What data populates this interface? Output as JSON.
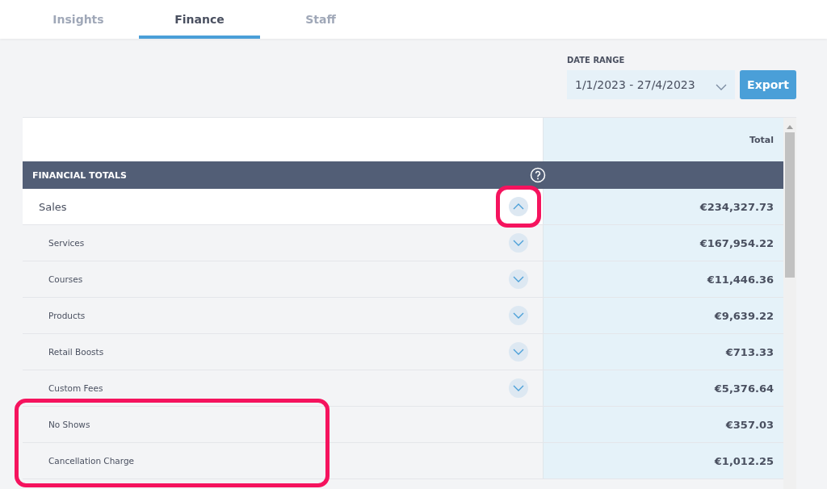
{
  "tabs": [
    {
      "label": "Insights",
      "selected": false
    },
    {
      "label": "Finance",
      "selected": true
    },
    {
      "label": "Staff",
      "selected": false
    }
  ],
  "date_range": {
    "label": "DATE RANGE",
    "value": "1/1/2023 - 27/4/2023"
  },
  "export_button": "Export",
  "table": {
    "column_header": "Total",
    "section": {
      "title": "FINANCIAL TOTALS"
    },
    "rows": [
      {
        "kind": "parent",
        "label": "Sales",
        "value": "€234,327.73",
        "expanded": true,
        "highlighted": true
      },
      {
        "kind": "child",
        "label": "Services",
        "value": "€167,954.22",
        "expanded": false,
        "highlighted": false
      },
      {
        "kind": "child",
        "label": "Courses",
        "value": "€11,446.36",
        "expanded": false,
        "highlighted": false
      },
      {
        "kind": "child",
        "label": "Products",
        "value": "€9,639.22",
        "expanded": false,
        "highlighted": false
      },
      {
        "kind": "child",
        "label": "Retail Boosts",
        "value": "€713.33",
        "expanded": false,
        "highlighted": false
      },
      {
        "kind": "child",
        "label": "Custom Fees",
        "value": "€5,376.64",
        "expanded": false,
        "highlighted": false
      },
      {
        "kind": "leaf",
        "label": "No Shows",
        "value": "€357.03",
        "highlighted": true
      },
      {
        "kind": "leaf",
        "label": "Cancellation Charge",
        "value": "€1,012.25",
        "highlighted": true
      }
    ]
  }
}
